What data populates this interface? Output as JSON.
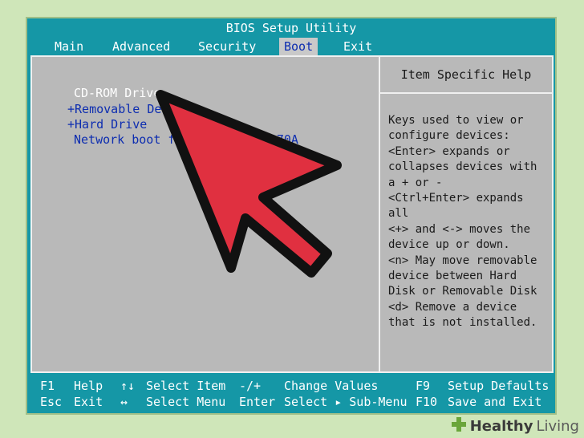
{
  "window": {
    "title": "BIOS Setup Utility"
  },
  "menu": {
    "items": [
      {
        "label": "Main"
      },
      {
        "label": "Advanced"
      },
      {
        "label": "Security"
      },
      {
        "label": "Boot"
      },
      {
        "label": "Exit"
      }
    ],
    "active": "Boot"
  },
  "boot": {
    "items": [
      {
        "label": "CD-ROM Drive"
      },
      {
        "label": "+Removable Devices"
      },
      {
        "label": "+Hard Drive"
      },
      {
        "label": "Network boot from AMD Am79C970A"
      }
    ],
    "selected": "CD-ROM Drive"
  },
  "help": {
    "title": "Item Specific Help",
    "body": "Keys used to view or\nconfigure devices:\n<Enter> expands or\ncollapses devices with\na + or -\n<Ctrl+Enter> expands\nall\n<+> and <-> moves the\ndevice up or down.\n<n> May move removable\ndevice between Hard\nDisk or Removable Disk\n<d> Remove a device\nthat is not installed."
  },
  "status": {
    "f1": "F1",
    "help": "Help",
    "updown": "↑↓",
    "select_item": "Select Item",
    "minusplus": "-/+",
    "change_values": "Change Values",
    "f9": "F9",
    "setup_defaults": "Setup Defaults",
    "esc": "Esc",
    "exit": "Exit",
    "leftright": "↔",
    "select_menu": "Select Menu",
    "enter": "Enter",
    "select_submenu": "Select ▸ Sub-Menu",
    "f10": "F10",
    "save_exit": "Save and Exit"
  },
  "watermark": {
    "brand_bold": "Healthy",
    "brand_light": "Living"
  },
  "colors": {
    "bios_teal": "#1597a6",
    "panel_gray": "#b9b9b9",
    "item_blue": "#0d2db0",
    "arrow_red": "#e03040",
    "background_green": "#cfe6b9"
  }
}
